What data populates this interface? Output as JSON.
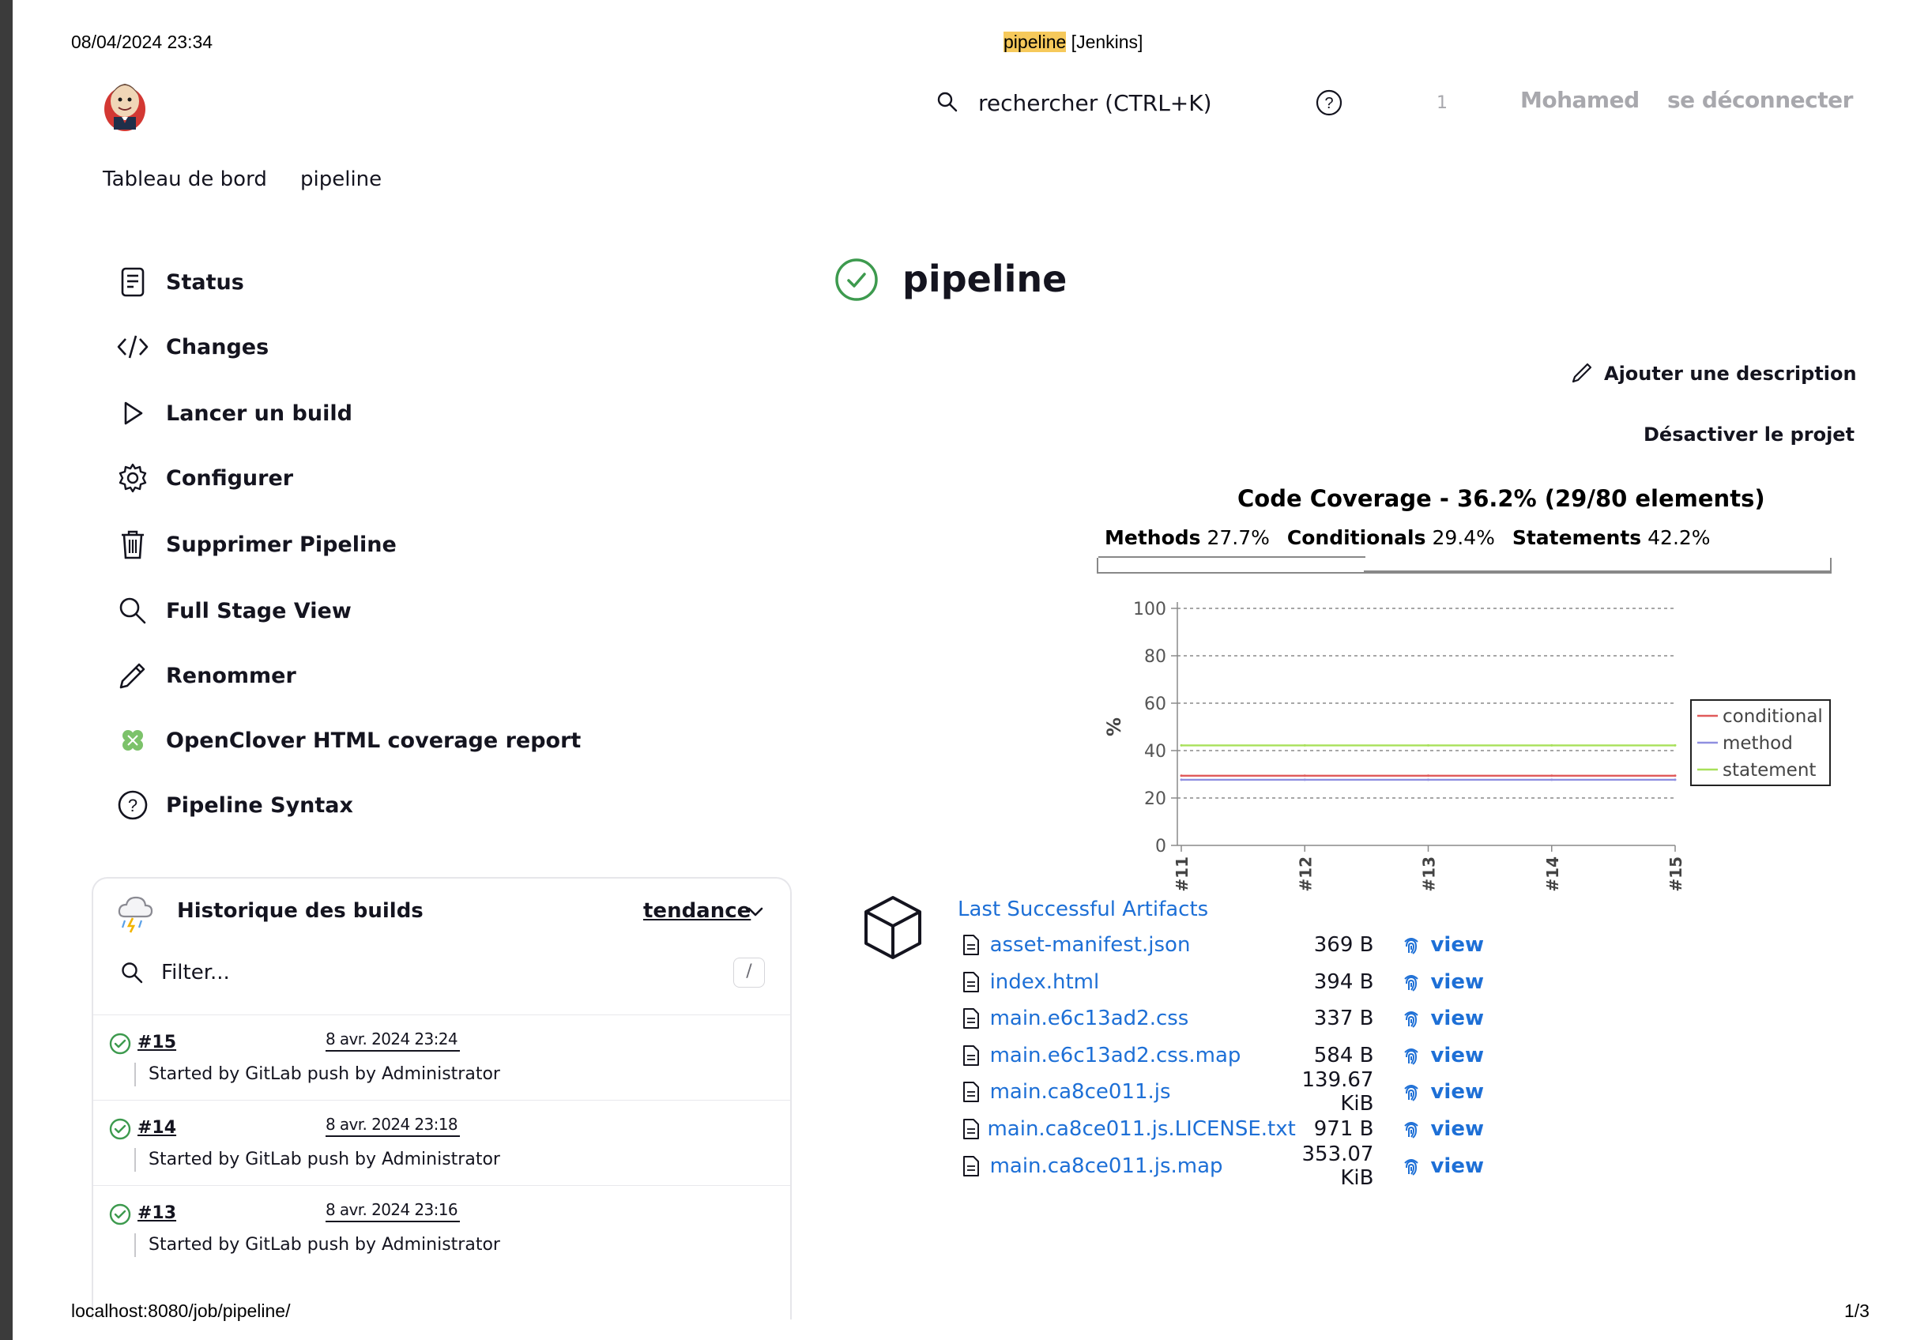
{
  "print_header": {
    "datetime": "08/04/2024 23:34",
    "title_highlight": "pipeline",
    "title_rest": " [Jenkins]"
  },
  "print_footer": {
    "url": "localhost:8080/job/pipeline/",
    "page": "1/3"
  },
  "header": {
    "search_placeholder": "rechercher (CTRL+K)",
    "notification_count": "1",
    "user": "Mohamed",
    "logout": "se déconnecter"
  },
  "breadcrumb": {
    "items": [
      "Tableau de bord",
      "pipeline"
    ]
  },
  "sidebar": {
    "items": [
      {
        "label": "Status",
        "icon": "document-icon"
      },
      {
        "label": "Changes",
        "icon": "code-icon"
      },
      {
        "label": "Lancer un build",
        "icon": "play-icon"
      },
      {
        "label": "Configurer",
        "icon": "gear-icon"
      },
      {
        "label": "Supprimer Pipeline",
        "icon": "trash-icon"
      },
      {
        "label": "Full Stage View",
        "icon": "search-icon"
      },
      {
        "label": "Renommer",
        "icon": "pencil-icon"
      },
      {
        "label": "OpenClover HTML coverage report",
        "icon": "clover-icon"
      },
      {
        "label": "Pipeline Syntax",
        "icon": "help-icon"
      }
    ]
  },
  "main": {
    "title": "pipeline",
    "add_description": "Ajouter une description",
    "disable_project": "Désactiver le projet"
  },
  "coverage": {
    "title": "Code Coverage - 36.2% (29/80 elements)",
    "methods_label": "Methods",
    "methods_value": "27.7%",
    "conditionals_label": "Conditionals",
    "conditionals_value": "29.4%",
    "statements_label": "Statements",
    "statements_value": "42.2%",
    "colors": {
      "conditional": "#e05a5a",
      "method": "#8f8fe0",
      "statement": "#a8e05a"
    }
  },
  "chart_data": {
    "type": "line",
    "x": [
      "#11",
      "#12",
      "#13",
      "#14",
      "#15"
    ],
    "ylabel": "%",
    "ylim": [
      0,
      100
    ],
    "yticks": [
      0,
      20,
      40,
      60,
      80,
      100
    ],
    "grid": true,
    "legend_position": "right",
    "series": [
      {
        "name": "conditional",
        "values": [
          29.4,
          29.4,
          29.4,
          29.4,
          29.4
        ]
      },
      {
        "name": "method",
        "values": [
          27.7,
          27.7,
          27.7,
          27.7,
          27.7
        ]
      },
      {
        "name": "statement",
        "values": [
          42.2,
          42.2,
          42.2,
          42.2,
          42.2
        ]
      }
    ]
  },
  "artifacts": {
    "title": "Last Successful Artifacts",
    "view_label": "view",
    "items": [
      {
        "name": "asset-manifest.json",
        "size": "369 B"
      },
      {
        "name": "index.html",
        "size": "394 B"
      },
      {
        "name": "main.e6c13ad2.css",
        "size": "337 B"
      },
      {
        "name": "main.e6c13ad2.css.map",
        "size": "584 B"
      },
      {
        "name": "main.ca8ce011.js",
        "size": "139.67 KiB"
      },
      {
        "name": "main.ca8ce011.js.LICENSE.txt",
        "size": "971 B"
      },
      {
        "name": "main.ca8ce011.js.map",
        "size": "353.07 KiB"
      }
    ]
  },
  "history": {
    "title": "Historique des builds",
    "trend": "tendance",
    "filter_placeholder": "Filter...",
    "filter_shortcut": "/",
    "builds": [
      {
        "number": "#15",
        "date": "8 avr. 2024 23:24",
        "desc": "Started by GitLab push by Administrator"
      },
      {
        "number": "#14",
        "date": "8 avr. 2024 23:18",
        "desc": "Started by GitLab push by Administrator"
      },
      {
        "number": "#13",
        "date": "8 avr. 2024 23:16",
        "desc": "Started by GitLab push by Administrator"
      }
    ]
  }
}
